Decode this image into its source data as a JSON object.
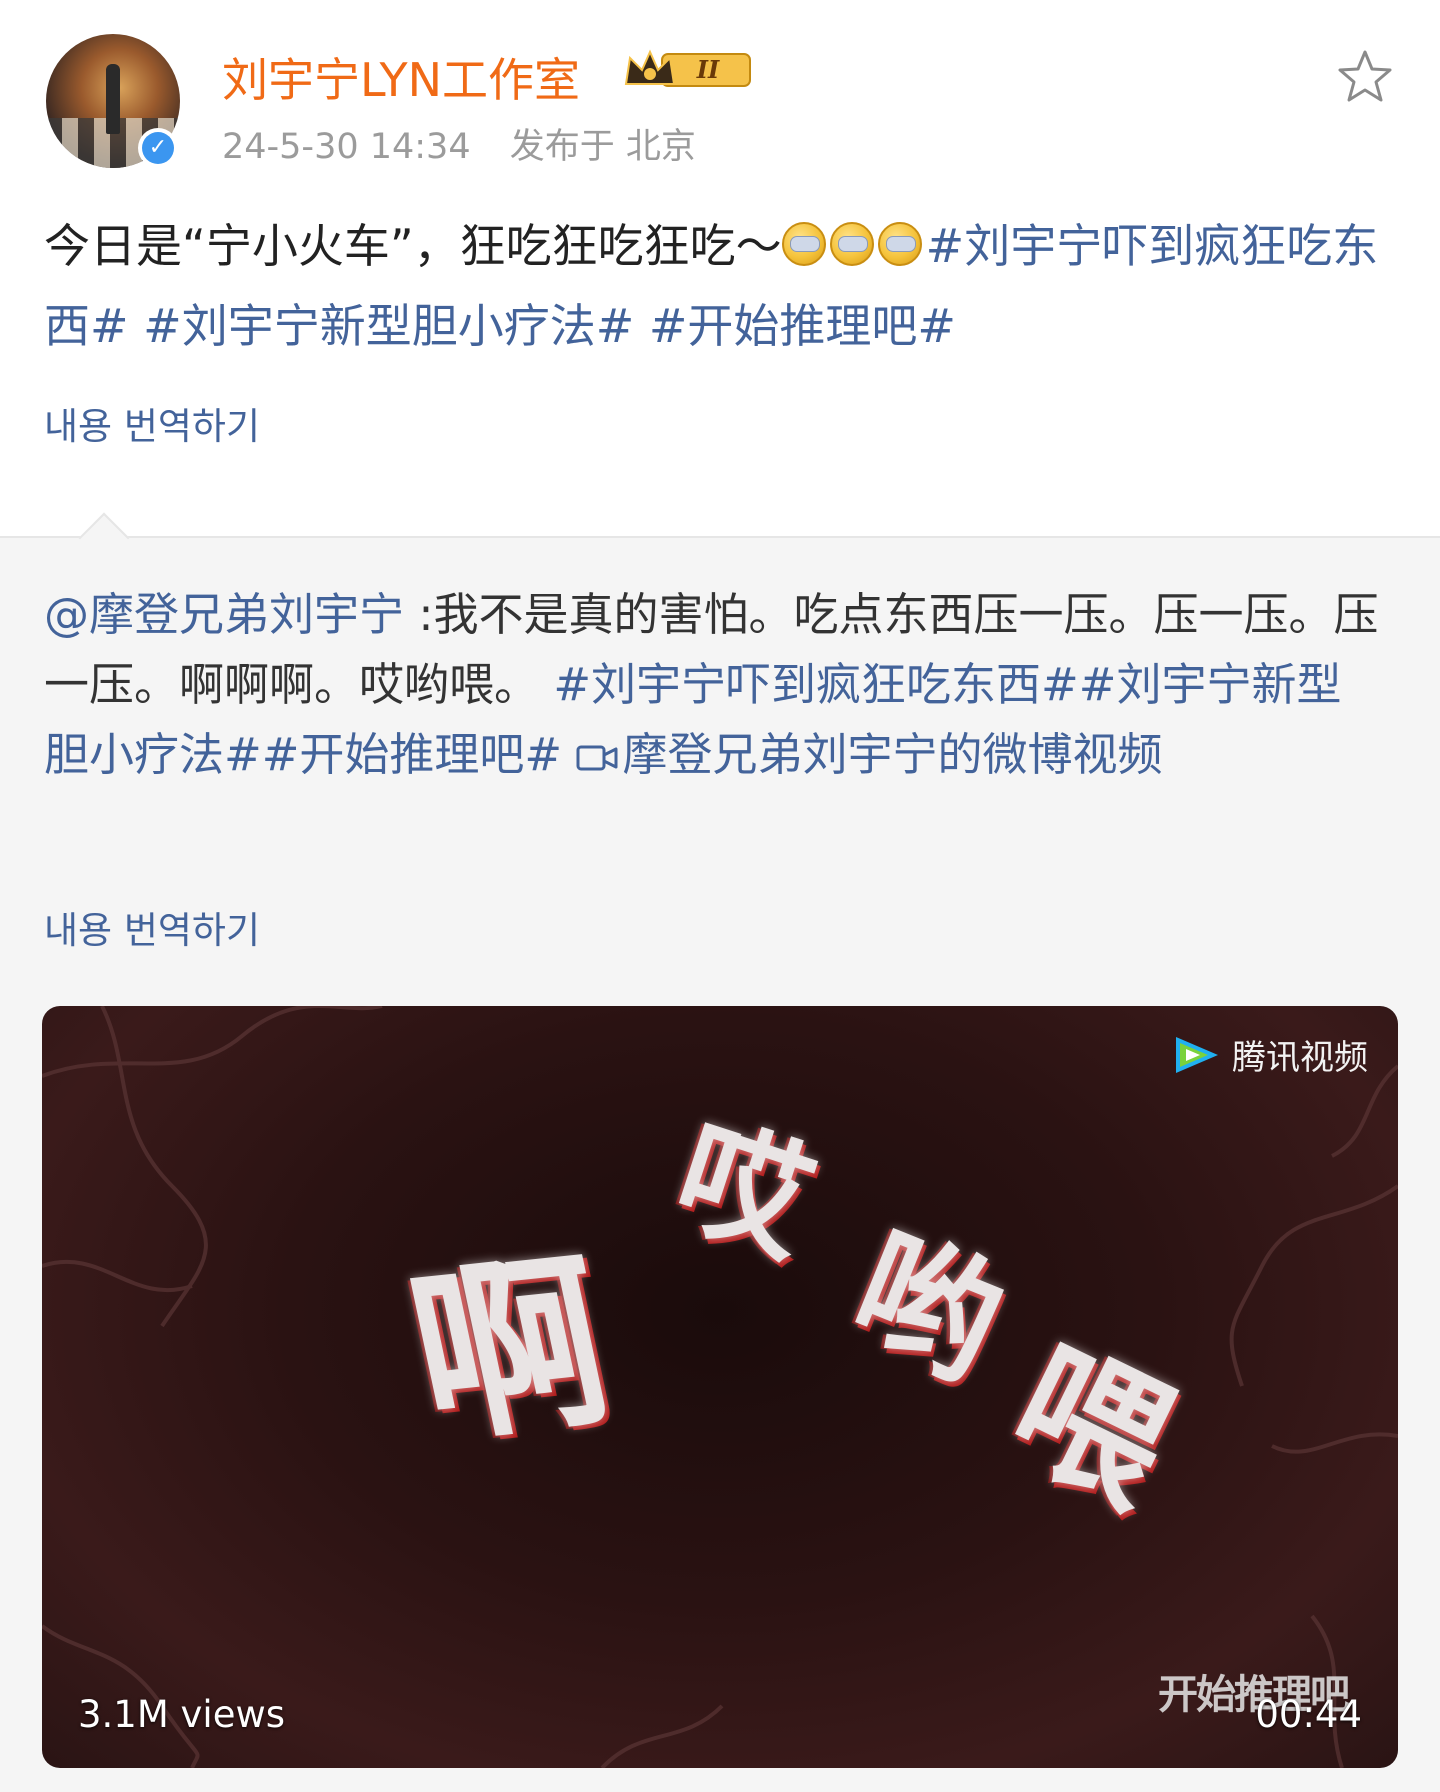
{
  "post": {
    "username": "刘宇宁LYN工作室",
    "member_level": "II",
    "timestamp": "24-5-30 14:34",
    "location": "发布于 北京",
    "text_plain": "今日是“宁小火车”，狂吃狂吃狂吃～",
    "hashtags": [
      "#刘宇宁吓到疯狂吃东西#",
      "#刘宇宁新型胆小疗法#",
      "#开始推理吧#"
    ],
    "translate_label": "내용 번역하기"
  },
  "retweet": {
    "mention": "@摩登兄弟刘宇宁",
    "text": " :我不是真的害怕。吃点东西压一压。压一压。压一压。啊啊啊。哎哟喂。",
    "hashtags": "#刘宇宁吓到疯狂吃东西##刘宇宁新型胆小疗法##开始推理吧#",
    "video_link": "摩登兄弟刘宇宁的微博视频",
    "translate_label": "내용 번역하기"
  },
  "video": {
    "watermark": "腾讯视频",
    "overlay_chars": [
      "啊",
      "哎",
      "哟",
      "喂"
    ],
    "show_logo": "开始推理吧",
    "views": "3.1M views",
    "duration": "00:44"
  },
  "colors": {
    "username": "#f06a16",
    "link": "#43639a",
    "meta": "#9b9b9b"
  },
  "icons": [
    "crown-badge-icon",
    "verified-icon",
    "star-favorite-icon",
    "emoji-icon",
    "video-camera-icon",
    "tencent-video-logo-icon"
  ]
}
